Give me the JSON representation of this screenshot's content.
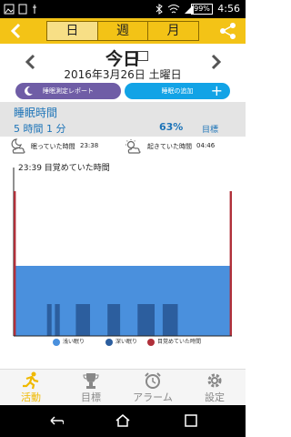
{
  "status": {
    "time": "4:56",
    "battery": "99%"
  },
  "header": {
    "tabs": [
      {
        "label": "日",
        "active": true
      },
      {
        "label": "週",
        "active": false
      },
      {
        "label": "月",
        "active": false
      }
    ]
  },
  "date": {
    "title": "今日",
    "line": "2016年3月26日 土曜日"
  },
  "buttons": {
    "report": "睡眠測定レポート",
    "add": "睡眠の追加"
  },
  "sleep": {
    "title": "睡眠時間",
    "duration": "5 時間 1 分",
    "percent": "63%",
    "goal": "目標"
  },
  "times": {
    "slept_label": "眠っていた時間",
    "slept_time": "23:38",
    "woke_label": "起きていた時間",
    "woke_time": "04:46"
  },
  "chart": {
    "annotation": "23:39 目覚めていた時間"
  },
  "legend": {
    "light": "浅い眠り",
    "deep": "深い眠り",
    "awake": "目覚めていた時間"
  },
  "nav": [
    {
      "label": "活動",
      "active": true
    },
    {
      "label": "目標",
      "active": false
    },
    {
      "label": "アラーム",
      "active": false
    },
    {
      "label": "設定",
      "active": false
    }
  ],
  "colors": {
    "accent": "#f3c316",
    "light_sleep": "#4a90dd",
    "deep_sleep": "#2c5e9e",
    "awake": "#b0303a"
  },
  "chart_data": {
    "type": "bar",
    "series": [
      {
        "name": "浅い眠り",
        "segments": [
          [
            0.0,
            1.0
          ]
        ]
      },
      {
        "name": "深い眠り",
        "segments": [
          [
            0.153,
            0.174
          ],
          [
            0.189,
            0.211
          ],
          [
            0.285,
            0.35
          ],
          [
            0.43,
            0.488
          ],
          [
            0.568,
            0.646
          ],
          [
            0.683,
            0.752
          ]
        ]
      },
      {
        "name": "目覚めていた時間",
        "segments": [
          [
            0.0,
            0.01
          ],
          [
            0.99,
            1.0
          ]
        ]
      }
    ]
  }
}
